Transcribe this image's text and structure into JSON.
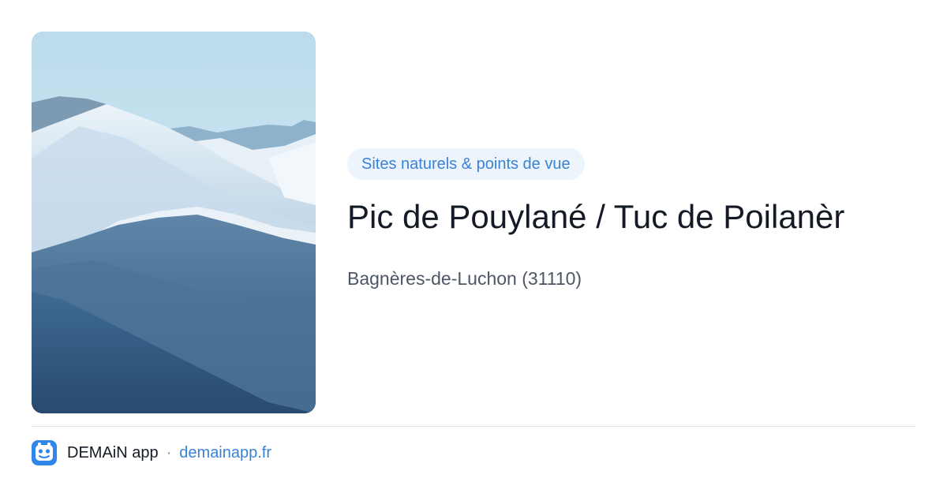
{
  "place": {
    "category": "Sites naturels & points de vue",
    "title": "Pic de Pouylané / Tuc de Poilanèr",
    "location": "Bagnères-de-Luchon (31110)",
    "photo_icon": "mountain-photo"
  },
  "footer": {
    "app_name": "DEMAiN app",
    "separator": "·",
    "site": "demainapp.fr",
    "app_icon": "demain-app-logo-icon"
  },
  "colors": {
    "accent": "#3a82d6",
    "chip_bg": "#eef4fc",
    "title": "#141a26",
    "muted": "#4d5666",
    "divider": "#dde6ec"
  }
}
